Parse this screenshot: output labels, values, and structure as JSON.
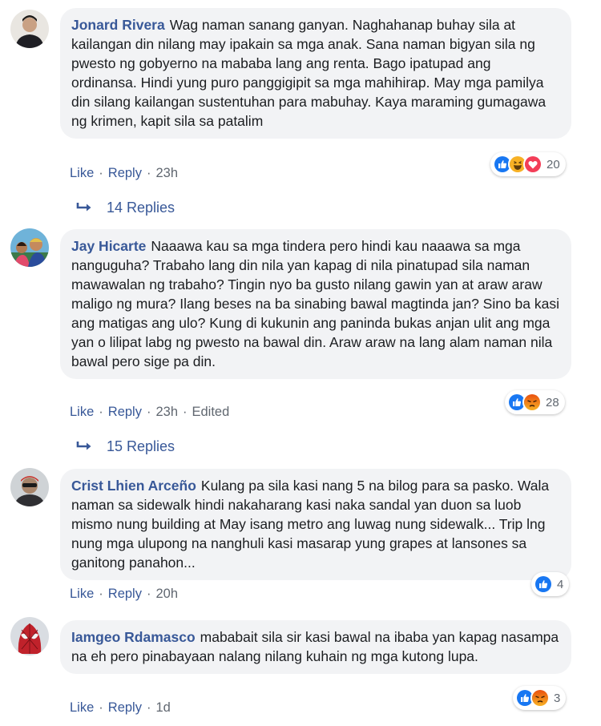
{
  "comments": [
    {
      "author": "Jonard Rivera",
      "text": "Wag naman sanang ganyan. Naghahanap buhay sila at kailangan din nilang may ipakain sa mga anak. Sana naman bigyan sila ng pwesto ng gobyerno na mababa lang ang renta. Bago ipatupad ang ordinansa. Hindi yung puro panggigipit sa mga mahihirap. May mga pamilya din silang kailangan sustentuhan para mabuhay. Kaya maraming gumagawa ng krimen, kapit sila sa patalim",
      "like": "Like",
      "reply": "Reply",
      "time": "23h",
      "reaction_count": "20",
      "reactions": [
        "like-icon",
        "haha-icon",
        "love-icon"
      ],
      "replies_label": "14 Replies"
    },
    {
      "author": "Jay Hicarte",
      "text": "Naaawa kau sa mga tindera pero hindi kau naaawa sa mga nanguguha? Trabaho lang din nila yan kapag di nila pinatupad sila naman mawawalan ng trabaho? Tingin nyo ba gusto nilang gawin yan at araw araw maligo ng mura? Ilang beses na ba sinabing bawal magtinda jan? Sino ba kasi ang matigas ang ulo? Kung di kukunin ang paninda bukas anjan ulit ang mga yan o lilipat labg ng pwesto na bawal din. Araw araw na lang alam naman nila bawal pero sige pa din.",
      "like": "Like",
      "reply": "Reply",
      "time": "23h",
      "edited": "Edited",
      "reaction_count": "28",
      "reactions": [
        "like-icon",
        "angry-icon"
      ],
      "replies_label": "15 Replies"
    },
    {
      "author": "Crist Lhien Arceño",
      "text": "Kulang pa sila kasi nang 5 na bilog para sa pasko. Wala naman sa sidewalk hindi nakaharang kasi naka sandal yan duon sa luob mismo nung building at May isang metro ang luwag nung sidewalk... Trip lng nung mga ulupong na nanghuli kasi masarap yung grapes at lansones sa ganitong panahon...",
      "like": "Like",
      "reply": "Reply",
      "time": "20h",
      "reaction_count": "4",
      "reactions": [
        "like-icon"
      ]
    },
    {
      "author": "Iamgeo Rdamasco",
      "text": "mababait sila sir kasi bawal na ibaba yan kapag nasampa na eh pero pinabayaan nalang nilang kuhain ng mga kutong lupa.",
      "like": "Like",
      "reply": "Reply",
      "time": "1d",
      "reaction_count": "3",
      "reactions": [
        "like-icon",
        "angry-icon"
      ]
    }
  ],
  "colors": {
    "link": "#385898",
    "bubble": "#f2f3f5",
    "like": "#1877f2",
    "love": "#f33e58",
    "haha": "#f7b125",
    "angry": "#e9710f"
  }
}
